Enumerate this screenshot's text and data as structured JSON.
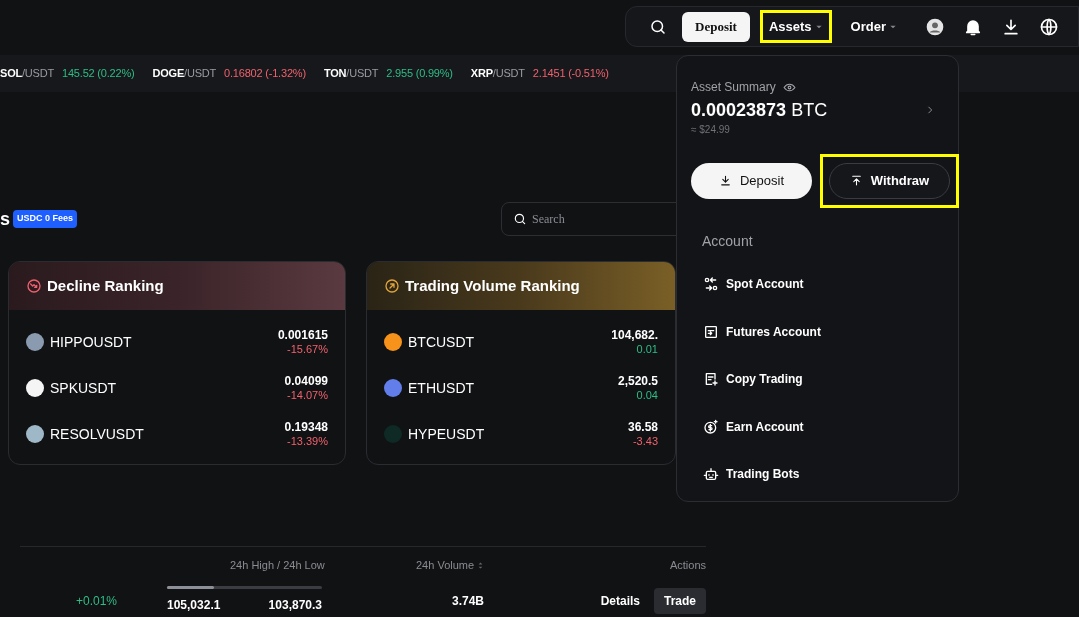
{
  "header": {
    "deposit_button": "Deposit",
    "nav": [
      {
        "label": "Assets",
        "highlighted": true
      },
      {
        "label": "Order",
        "highlighted": false
      }
    ]
  },
  "ticker": [
    {
      "base": "SOL",
      "quote": "/USDT",
      "quote_text": "145.52 (0.22%)",
      "negative": false
    },
    {
      "base": "DOGE",
      "quote": "/USDT",
      "quote_text": "0.16802 (-1.32%)",
      "negative": true
    },
    {
      "base": "TON",
      "quote": "/USDT",
      "quote_text": "2.955 (0.99%)",
      "negative": false
    },
    {
      "base": "XRP",
      "quote": "/USDT",
      "quote_text": "2.1451 (-0.51%)",
      "negative": true
    }
  ],
  "section": {
    "heading": "s",
    "badge": "USDC 0 Fees",
    "search": {
      "placeholder": "Search"
    }
  },
  "rankings": [
    {
      "title": "Decline Ranking",
      "kind": "decline",
      "rows": [
        {
          "symbol": "HIPPOUSDT",
          "price": "0.001615",
          "change": "-15.67%",
          "negative": true,
          "color": "#8a9bb0"
        },
        {
          "symbol": "SPKUSDT",
          "price": "0.04099",
          "change": "-14.07%",
          "negative": true,
          "color": "#f5f5f5"
        },
        {
          "symbol": "RESOLVUSDT",
          "price": "0.19348",
          "change": "-13.39%",
          "negative": true,
          "color": "#9fb8c8"
        }
      ]
    },
    {
      "title": "Trading Volume Ranking",
      "kind": "volume",
      "rows": [
        {
          "symbol": "BTCUSDT",
          "price": "104,682.",
          "change": "0.01",
          "negative": false,
          "color": "#f7931a"
        },
        {
          "symbol": "ETHUSDT",
          "price": "2,520.5",
          "change": "0.04",
          "negative": false,
          "color": "#627eea"
        },
        {
          "symbol": "HYPEUSDT",
          "price": "36.58",
          "change": "-3.43",
          "negative": true,
          "color": "#0f2a24"
        }
      ]
    }
  ],
  "market_table": {
    "columns": [
      {
        "label": "24h High / 24h Low",
        "sortable": false
      },
      {
        "label": "24h Volume",
        "sortable": true
      },
      {
        "label": "Actions",
        "sortable": false
      }
    ],
    "rows": [
      {
        "change": "+0.01%",
        "negative": false,
        "level": 0.3,
        "high": "105,032.1",
        "low": "103,870.3",
        "volume": "3.74B",
        "actions": [
          {
            "label": "Details",
            "kind": "link"
          },
          {
            "label": "Trade",
            "kind": "button"
          }
        ]
      }
    ]
  },
  "assets_menu": {
    "title": "Asset Summary",
    "amount": "0.00023873",
    "unit": "BTC",
    "approx": "≈ $24.99",
    "buttons": [
      {
        "label": "Deposit",
        "kind": "primary",
        "highlighted": false
      },
      {
        "label": "Withdraw",
        "kind": "secondary",
        "highlighted": true
      }
    ],
    "section_label": "Account",
    "items": [
      {
        "label": "Spot Account",
        "kind": "spot"
      },
      {
        "label": "Futures Account",
        "kind": "futures"
      },
      {
        "label": "Copy Trading",
        "kind": "copy"
      },
      {
        "label": "Earn Account",
        "kind": "earn"
      },
      {
        "label": "Trading Bots",
        "kind": "bots"
      }
    ]
  }
}
